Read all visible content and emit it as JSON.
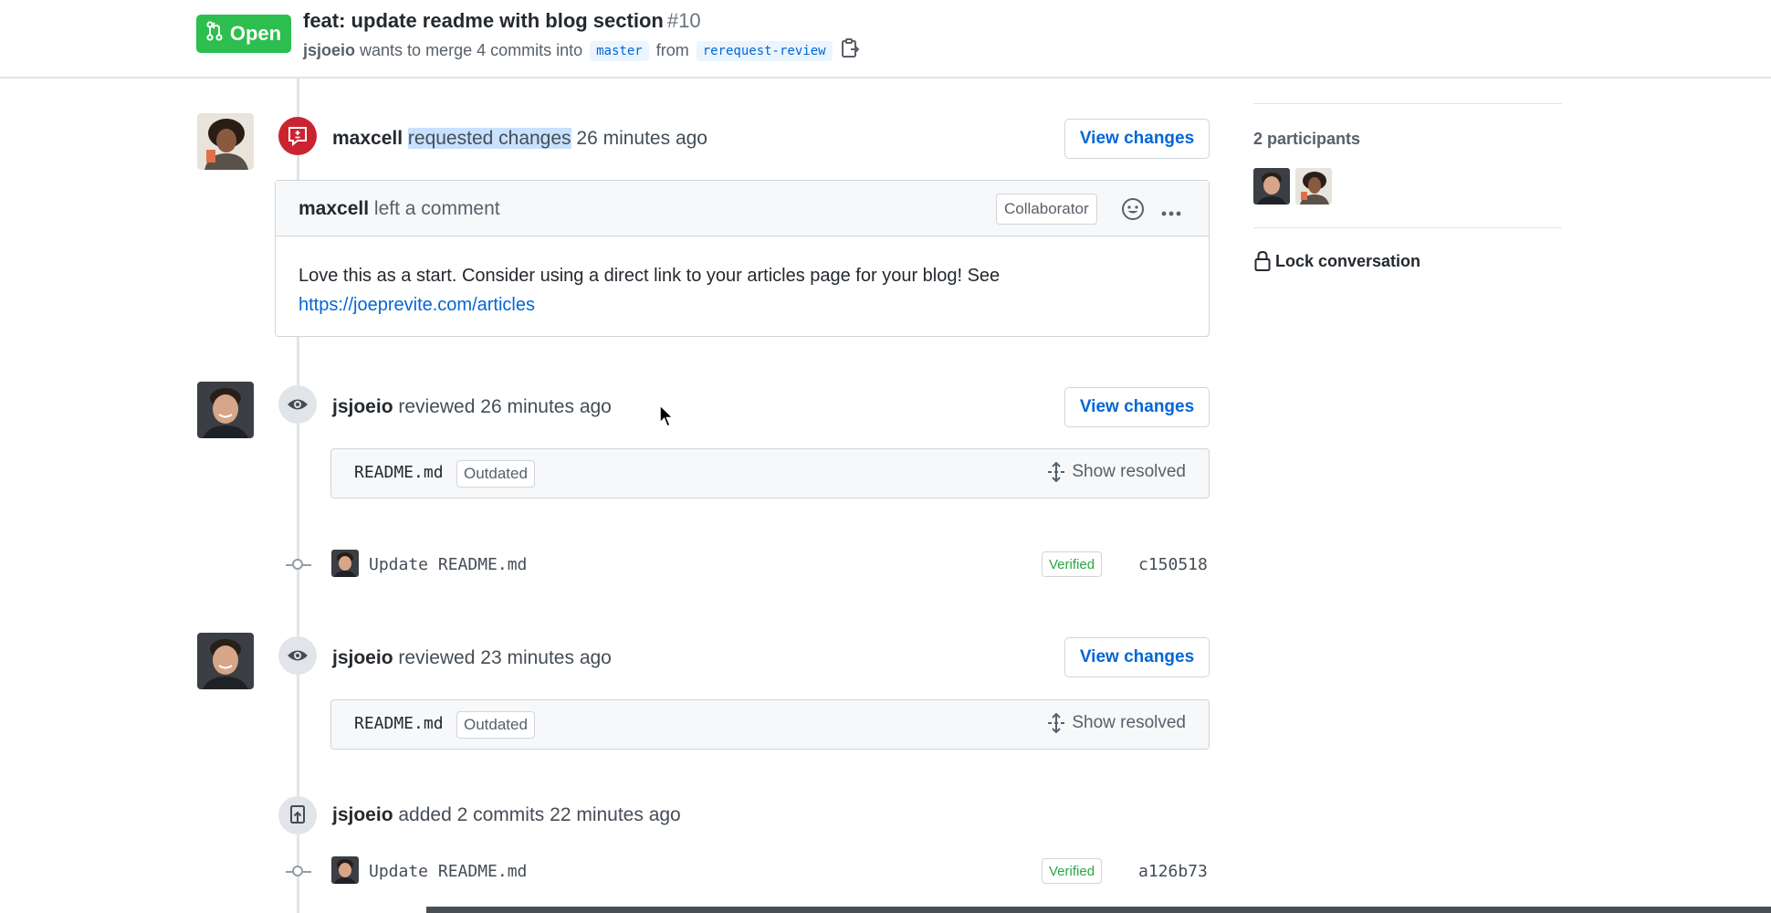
{
  "header": {
    "state_label": "Open",
    "title": "feat: update readme with blog section",
    "number": "#10",
    "author": "jsjoeio",
    "merge_text": "wants to merge 4 commits into",
    "base_branch": "master",
    "from_text": "from",
    "head_branch": "rerequest-review"
  },
  "timeline": {
    "review1": {
      "author": "maxcell",
      "action": "requested changes",
      "time": "26 minutes ago",
      "button": "View changes",
      "comment": {
        "author": "maxcell",
        "action": "left a comment",
        "role": "Collaborator",
        "body": "Love this as a start. Consider using a direct link to your articles page for your blog! See",
        "link": "https://joeprevite.com/articles"
      }
    },
    "review2": {
      "author": "jsjoeio",
      "action": "reviewed",
      "time": "26 minutes ago",
      "button": "View changes",
      "file": "README.md",
      "outdated": "Outdated",
      "show_resolved": "Show resolved"
    },
    "commit1": {
      "message": "Update README.md",
      "verified": "Verified",
      "sha": "c150518"
    },
    "review3": {
      "author": "jsjoeio",
      "action": "reviewed",
      "time": "23 minutes ago",
      "button": "View changes",
      "file": "README.md",
      "outdated": "Outdated",
      "show_resolved": "Show resolved"
    },
    "added": {
      "author": "jsjoeio",
      "action": "added 2 commits",
      "time": "22 minutes ago"
    },
    "commit2": {
      "message": "Update README.md",
      "verified": "Verified",
      "sha": "a126b73"
    }
  },
  "sidebar": {
    "participants_title": "2 participants",
    "lock_label": "Lock conversation"
  },
  "colors": {
    "open_green": "#2cbe4e",
    "changes_red": "#cb2431",
    "link_blue": "#0366d6",
    "verified_green": "#28a745"
  }
}
